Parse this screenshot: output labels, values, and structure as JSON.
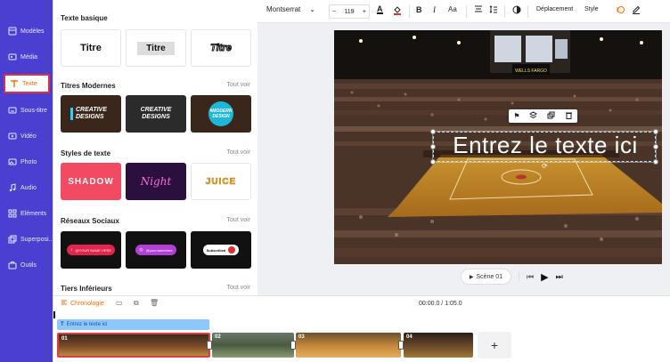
{
  "rail": {
    "items": [
      {
        "label": "Modèles",
        "icon": "template-icon"
      },
      {
        "label": "Média",
        "icon": "media-icon"
      },
      {
        "label": "Texte",
        "icon": "text-icon",
        "active": true
      },
      {
        "label": "Sous-titre",
        "icon": "subtitle-icon"
      },
      {
        "label": "Vidéo",
        "icon": "video-icon"
      },
      {
        "label": "Photo",
        "icon": "photo-icon"
      },
      {
        "label": "Audio",
        "icon": "audio-icon"
      },
      {
        "label": "Eléments",
        "icon": "elements-icon"
      },
      {
        "label": "Superposi...",
        "icon": "overlay-icon"
      },
      {
        "label": "Outils",
        "icon": "tools-icon"
      }
    ]
  },
  "panel": {
    "basic_title": "Texte basique",
    "basic_tiles": [
      "Titre",
      "Titre",
      "Titre"
    ],
    "modern_title": "Titres Modernes",
    "modern_see_all": "Tout voir",
    "modern_tiles": [
      "CREATIVE DESIGNS",
      "CREATIVE DESIGNS",
      "#MODERN DESIGN"
    ],
    "styles_title": "Styles de texte",
    "styles_see_all": "Tout voir",
    "styles_tiles": [
      "SHADOW",
      "Night",
      "JUICE"
    ],
    "social_title": "Réseaux Sociaux",
    "social_see_all": "Tout voir",
    "social_tiles": [
      "@YOUR NAME HERE",
      "@yournamehere",
      "Subscribed"
    ],
    "lower_title": "Tiers Inférieurs",
    "lower_see_all": "Tout voir"
  },
  "toolbar": {
    "font": "Montserrat",
    "size": "119",
    "minus": "−",
    "plus": "+",
    "bold": "B",
    "italic": "I",
    "case": "Aa",
    "move_label": "Déplacement",
    "style_label": "Style"
  },
  "canvas": {
    "overlay_text": "Entrez le texte ici",
    "scoreboard_text": "WELLS FARGO"
  },
  "player": {
    "scene_label": "Scène 01"
  },
  "timeline": {
    "chrono_label": "Chronologie",
    "time": "00:00.0 / 1:05.0",
    "text_track_label": "Entrez le texte ici",
    "clips": [
      "01",
      "02",
      "03",
      "04"
    ],
    "add_label": "+"
  },
  "colors": {
    "rail_bg": "#4a3fd1",
    "accent": "#ff6a00",
    "active_border": "#e0303a"
  }
}
